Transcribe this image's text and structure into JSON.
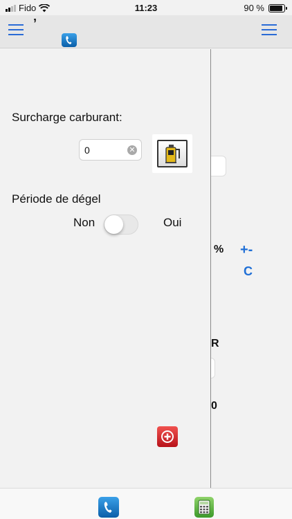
{
  "status_bar": {
    "carrier": "Fido",
    "time": "11:23",
    "battery": "90 %",
    "battery_level": 0.9
  },
  "nav": {
    "left_menu_icon": "menu-icon",
    "title_glyph": "’",
    "phone_icon": "phone-icon",
    "right_menu_icon": "menu-icon"
  },
  "fuel": {
    "label": "Surcharge carburant:",
    "value": "0",
    "clear_icon": "clear-icon",
    "button_icon": "fuel-can-icon"
  },
  "thaw": {
    "label": "Période de dégel",
    "off_label": "Non",
    "on_label": "Oui",
    "on": false
  },
  "right_panel": {
    "percent": "%",
    "plus_minus": "+-",
    "clear_key": "C",
    "frag_r": "R",
    "frag_zero": "0"
  },
  "add_button_icon": "add-circle-icon",
  "tabs": [
    {
      "icon": "phone-icon"
    },
    {
      "icon": "calculator-icon"
    }
  ],
  "colors": {
    "accent": "#1f6fd6",
    "add_red": "#c8171f",
    "calc_green": "#4fae38",
    "phone_blue": "#1676c8"
  }
}
